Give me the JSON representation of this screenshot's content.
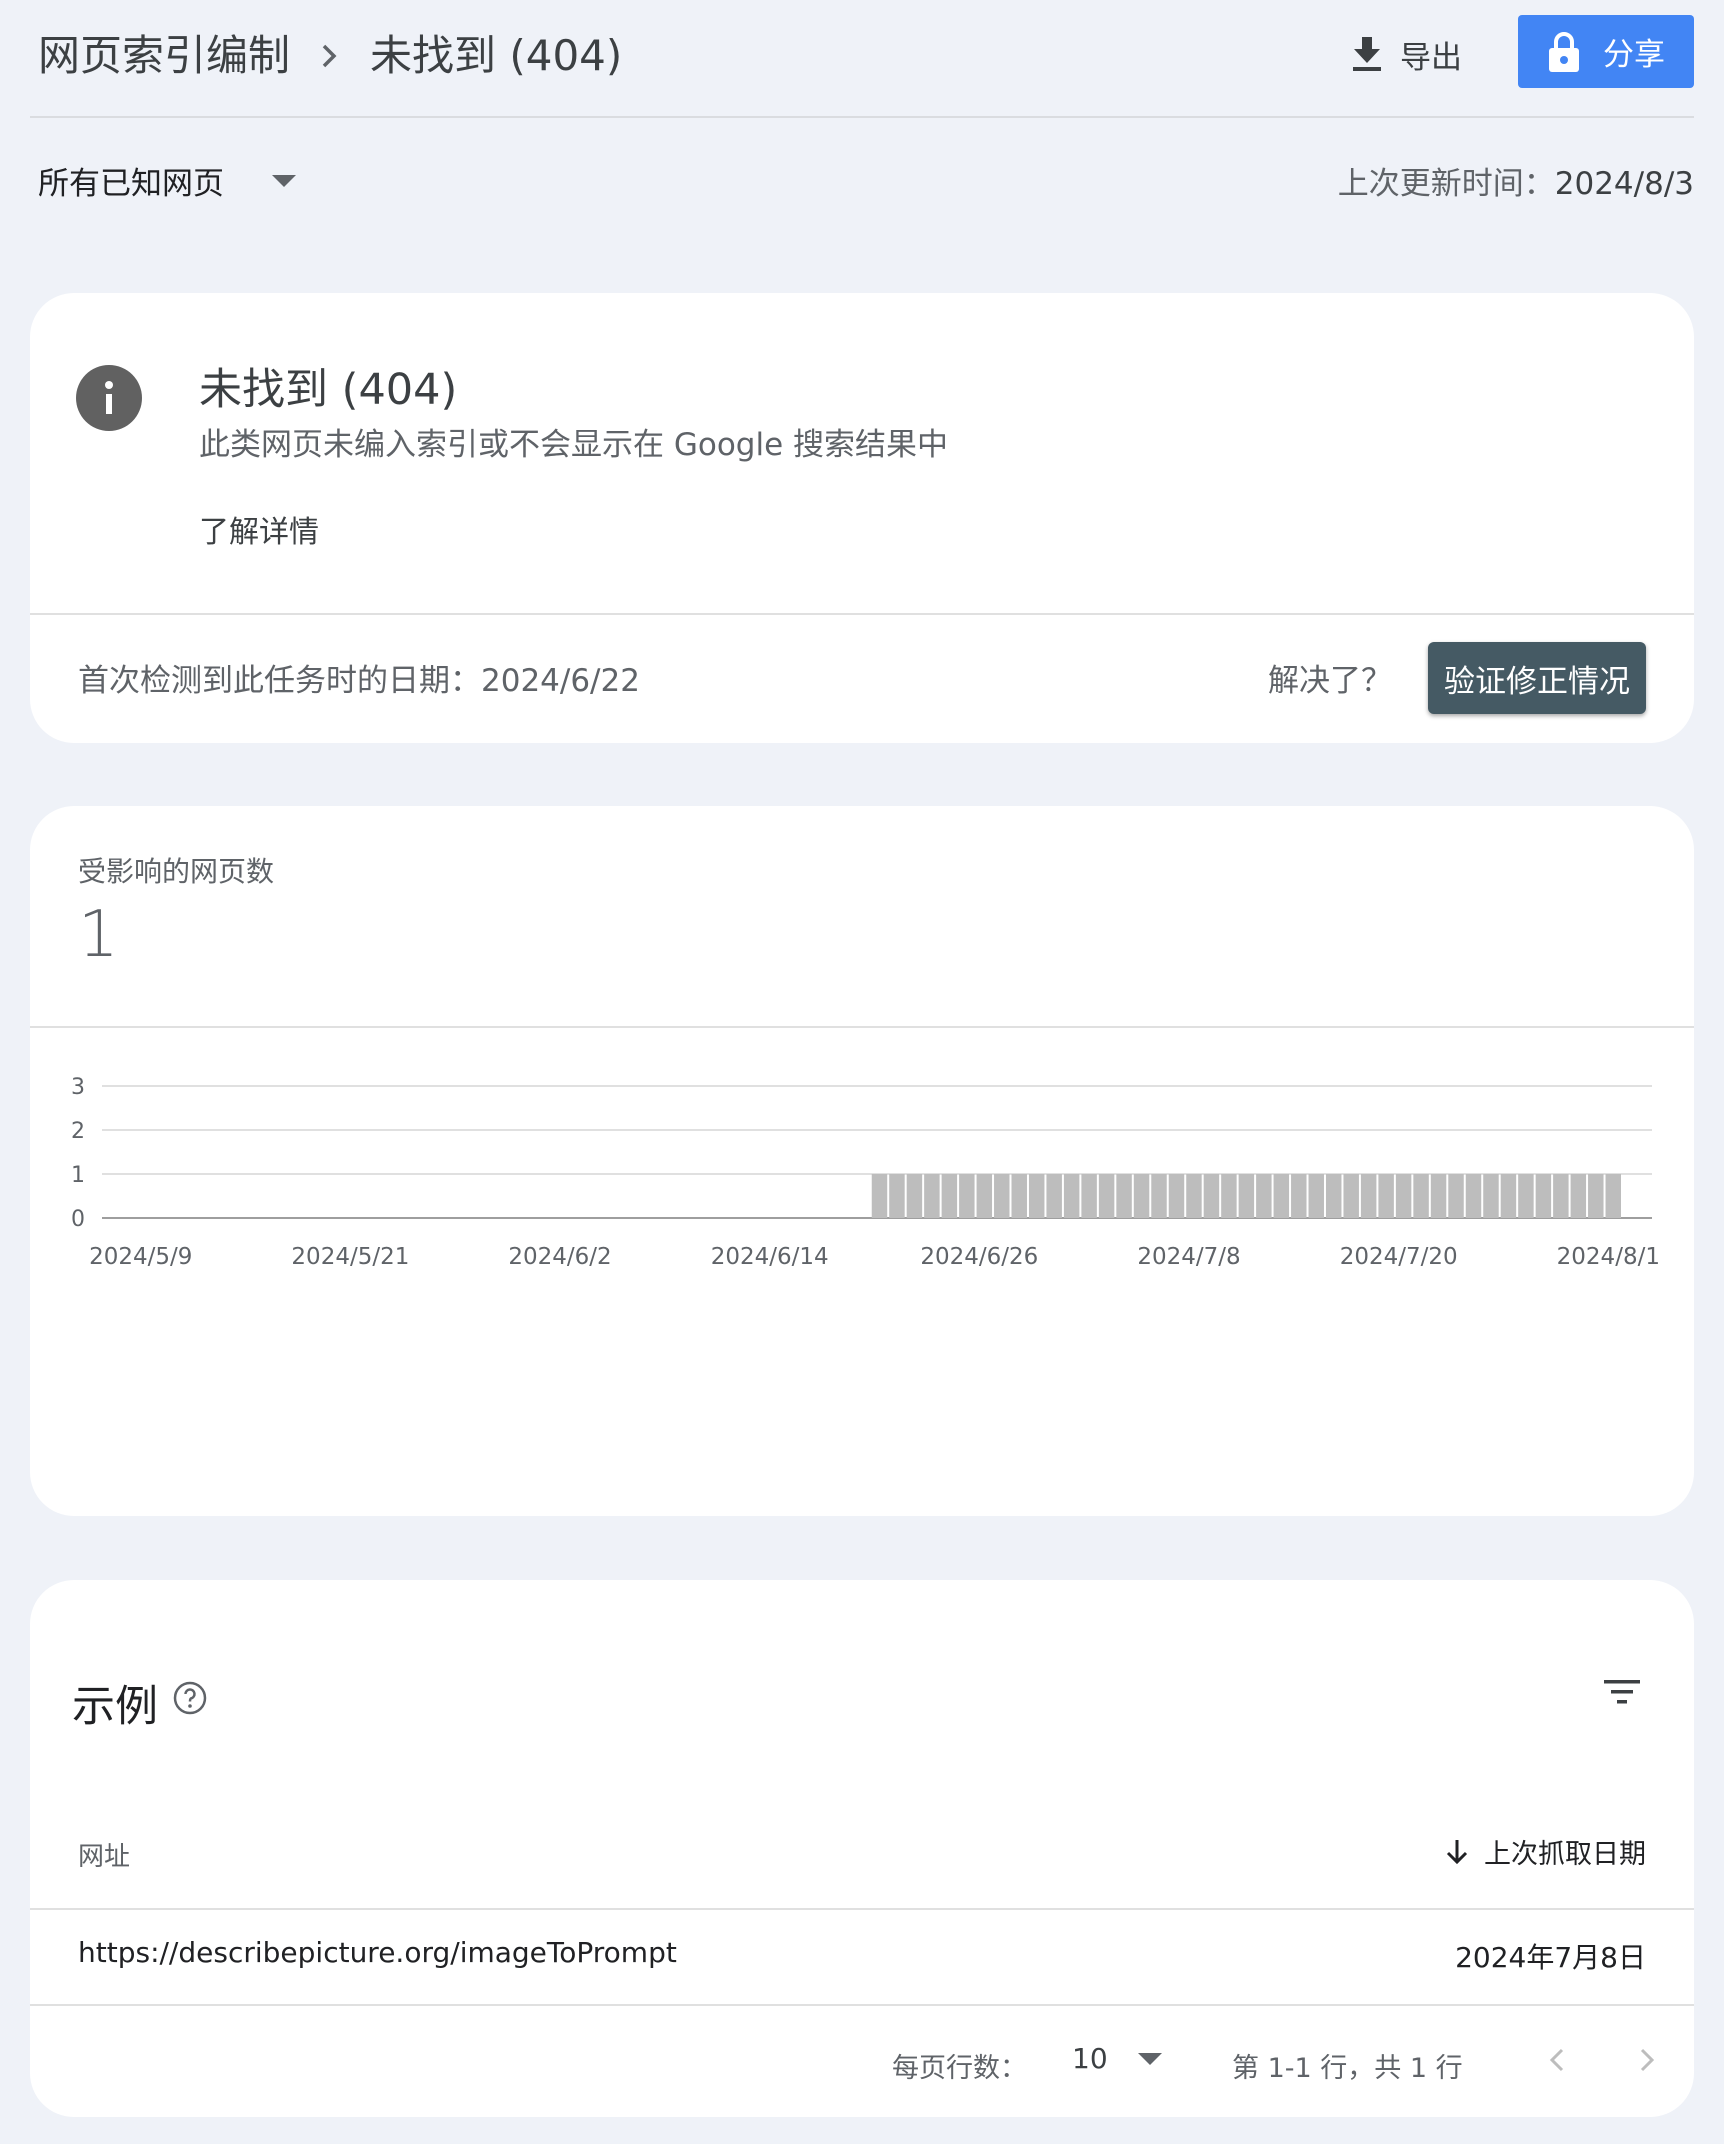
{
  "header": {
    "breadcrumb_parent": "网页索引编制",
    "breadcrumb_current": "未找到 (404)",
    "export_label": "导出",
    "share_label": "分享"
  },
  "filter": {
    "selected": "所有已知网页",
    "last_updated_label": "上次更新时间：",
    "last_updated_value": "2024/8/3"
  },
  "issue_card": {
    "title": "未找到 (404)",
    "subtitle": "此类网页未编入索引或不会显示在 Google 搜索结果中",
    "learn_more": "了解详情",
    "first_detected": "首次检测到此任务时的日期：2024/6/22",
    "resolved_label": "解决了？",
    "validate_button": "验证修正情况"
  },
  "chart_card": {
    "label": "受影响的网页数",
    "count": "1"
  },
  "chart_data": {
    "type": "bar",
    "ylim": [
      0,
      3
    ],
    "yticks": [
      "0",
      "1",
      "2",
      "3"
    ],
    "xtick_labels": [
      "2024/5/9",
      "2024/5/21",
      "2024/6/2",
      "2024/6/14",
      "2024/6/26",
      "2024/7/8",
      "2024/7/20",
      "2024/8/1"
    ],
    "x_start": "2024/5/9",
    "x_end": "2024/8/3",
    "values": [
      0,
      0,
      0,
      0,
      0,
      0,
      0,
      0,
      0,
      0,
      0,
      0,
      0,
      0,
      0,
      0,
      0,
      0,
      0,
      0,
      0,
      0,
      0,
      0,
      0,
      0,
      0,
      0,
      0,
      0,
      0,
      0,
      0,
      0,
      0,
      0,
      0,
      0,
      0,
      0,
      0,
      0,
      0,
      0,
      1,
      1,
      1,
      1,
      1,
      1,
      1,
      1,
      1,
      1,
      1,
      1,
      1,
      1,
      1,
      1,
      1,
      1,
      1,
      1,
      1,
      1,
      1,
      1,
      1,
      1,
      1,
      1,
      1,
      1,
      1,
      1,
      1,
      1,
      1,
      1,
      1,
      1,
      1,
      1,
      1,
      1,
      1
    ],
    "grid": true,
    "bar_color": "#bdbdbd"
  },
  "examples": {
    "title": "示例",
    "col_url": "网址",
    "col_last_crawl": "上次抓取日期",
    "rows": [
      {
        "url": "https://describepicture.org/imageToPrompt",
        "date": "2024年7月8日"
      }
    ],
    "rows_per_page_label": "每页行数：",
    "rows_per_page_value": "10",
    "range_text": "第 1-1 行，共 1 行"
  }
}
